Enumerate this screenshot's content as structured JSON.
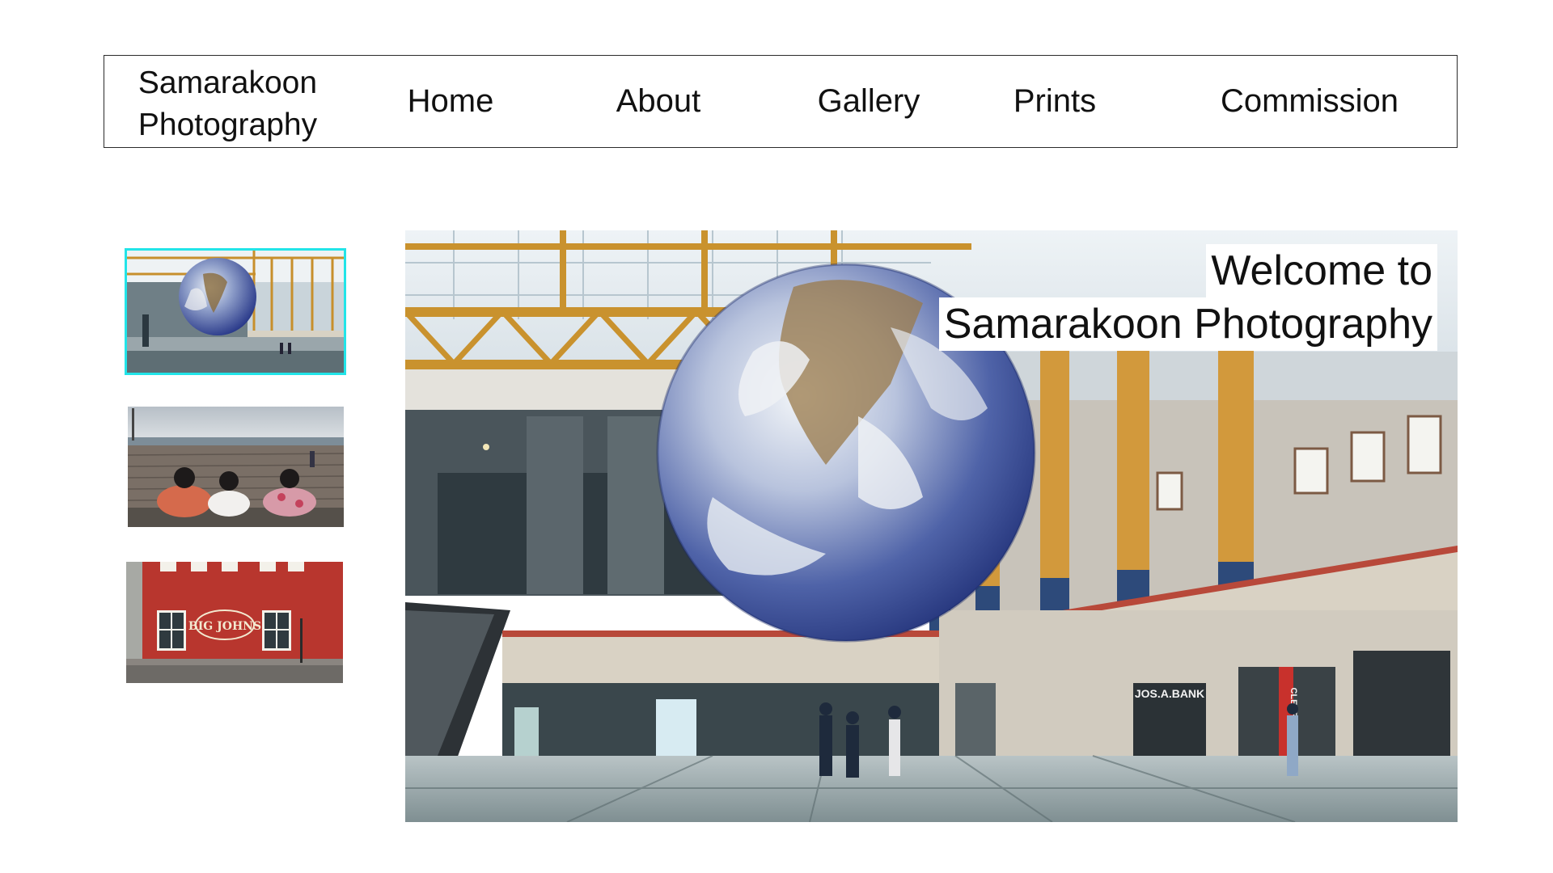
{
  "nav": {
    "brand_line1": "Samarakoon",
    "brand_line2": "Photography",
    "home": "Home",
    "about": "About",
    "gallery": "Gallery",
    "prints": "Prints",
    "commission": "Commission"
  },
  "hero": {
    "title_line1": "Welcome to",
    "title_line2": "Samarakoon Photography",
    "store_sign": "JOS.A.BANK",
    "banner_sign": "CLEARANCE"
  },
  "thumbnails": [
    {
      "subject": "globe-atrium",
      "selected": true
    },
    {
      "subject": "friends-on-pier",
      "selected": false
    },
    {
      "subject": "big-johns-building",
      "selected": false,
      "sign_text": "BIG JOHNS"
    }
  ],
  "colors": {
    "selected_outline": "#22e4e8",
    "nav_border": "#2b2b2b",
    "text": "#111111"
  }
}
